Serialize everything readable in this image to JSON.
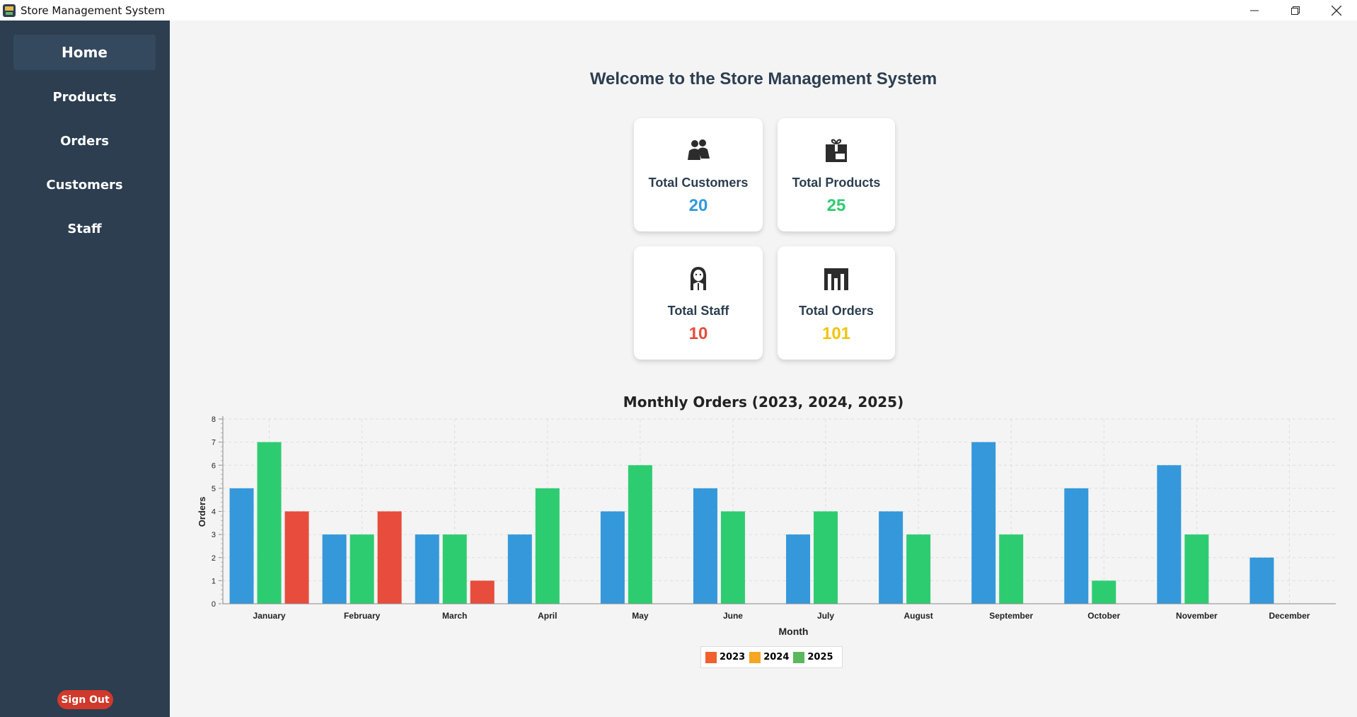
{
  "window": {
    "title": "Store Management System",
    "controls": [
      "minimize",
      "restore",
      "close"
    ]
  },
  "sidebar": {
    "items": [
      {
        "label": "Home",
        "active": true
      },
      {
        "label": "Products",
        "active": false
      },
      {
        "label": "Orders",
        "active": false
      },
      {
        "label": "Customers",
        "active": false
      },
      {
        "label": "Staff",
        "active": false
      }
    ],
    "signout_label": "Sign Out"
  },
  "main": {
    "welcome": "Welcome to the Store Management System",
    "stats": [
      {
        "label": "Total Customers",
        "value": "20",
        "color": "#3498db",
        "icon": "customers-icon"
      },
      {
        "label": "Total Products",
        "value": "25",
        "color": "#2ecc71",
        "icon": "products-icon"
      },
      {
        "label": "Total Staff",
        "value": "10",
        "color": "#e74c3c",
        "icon": "staff-icon"
      },
      {
        "label": "Total Orders",
        "value": "101",
        "color": "#f1c40f",
        "icon": "orders-icon"
      }
    ]
  },
  "chart_data": {
    "type": "bar",
    "title": "Monthly Orders (2023, 2024, 2025)",
    "xlabel": "Month",
    "ylabel": "Orders",
    "ylim": [
      0,
      8
    ],
    "yticks": [
      0,
      1,
      2,
      3,
      4,
      5,
      6,
      7,
      8
    ],
    "grid": true,
    "categories": [
      "January",
      "February",
      "March",
      "April",
      "May",
      "June",
      "July",
      "August",
      "September",
      "October",
      "November",
      "December"
    ],
    "series": [
      {
        "name": "2023",
        "bar_color": "#3498db",
        "values": [
          5,
          3,
          3,
          3,
          4,
          5,
          3,
          4,
          7,
          5,
          6,
          2
        ]
      },
      {
        "name": "2024",
        "bar_color": "#2ecc71",
        "values": [
          7,
          3,
          3,
          5,
          6,
          4,
          4,
          3,
          3,
          1,
          3,
          0
        ]
      },
      {
        "name": "2025",
        "bar_color": "#e74c3c",
        "values": [
          4,
          4,
          1,
          0,
          0,
          0,
          0,
          0,
          0,
          0,
          0,
          0
        ]
      }
    ],
    "legend": {
      "placement": "bottom-center",
      "items": [
        {
          "name": "2023",
          "color": "#f0612e"
        },
        {
          "name": "2024",
          "color": "#f5a623"
        },
        {
          "name": "2025",
          "color": "#5cb85c"
        }
      ]
    }
  }
}
